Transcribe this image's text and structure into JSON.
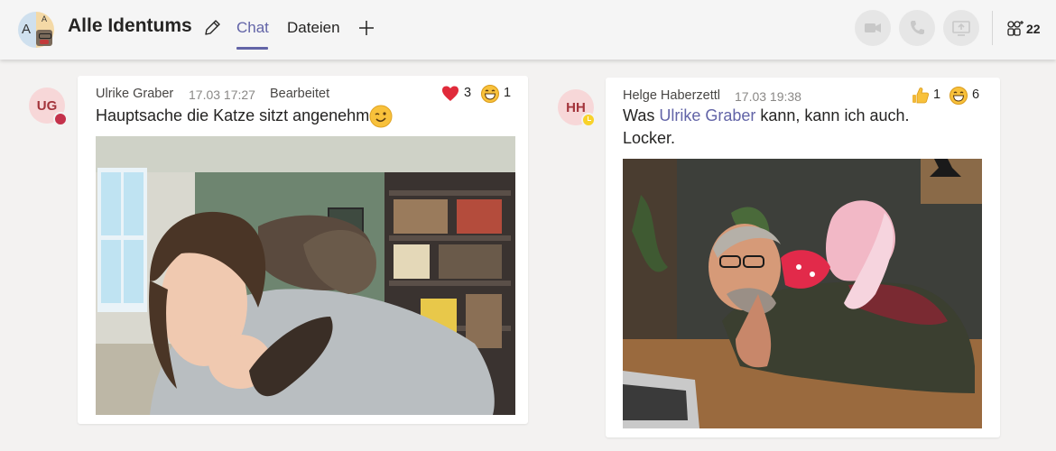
{
  "header": {
    "team_title": "Alle Identums",
    "avatar_letter_left": "A",
    "avatar_letter_right": "A",
    "tabs": [
      {
        "label": "Chat",
        "active": true
      },
      {
        "label": "Dateien",
        "active": false
      }
    ],
    "participants_count": "22",
    "accent_color": "#6264a7"
  },
  "messages": [
    {
      "avatar_initials": "UG",
      "presence": "busy",
      "sender": "Ulrike Graber",
      "timestamp": "17.03 17:27",
      "edited_label": "Bearbeitet",
      "text": "Hauptsache die Katze sitzt angenehm",
      "text_emoji": "winking-smile",
      "reactions": [
        {
          "icon": "heart",
          "count": "3"
        },
        {
          "icon": "laugh",
          "count": "1"
        }
      ],
      "image": "cat-on-shoulder-photo"
    },
    {
      "avatar_initials": "HH",
      "presence": "away",
      "sender": "Helge Haberzettl",
      "timestamp": "17.03 19:38",
      "text_prefix": "Was ",
      "mention": "Ulrike Graber",
      "text_suffix": " kann, kann ich auch.",
      "text_line2": "Locker.",
      "reactions": [
        {
          "icon": "thumbs-up",
          "count": "1"
        },
        {
          "icon": "laugh",
          "count": "6"
        }
      ],
      "image": "plush-toy-on-shoulder-photo"
    }
  ]
}
